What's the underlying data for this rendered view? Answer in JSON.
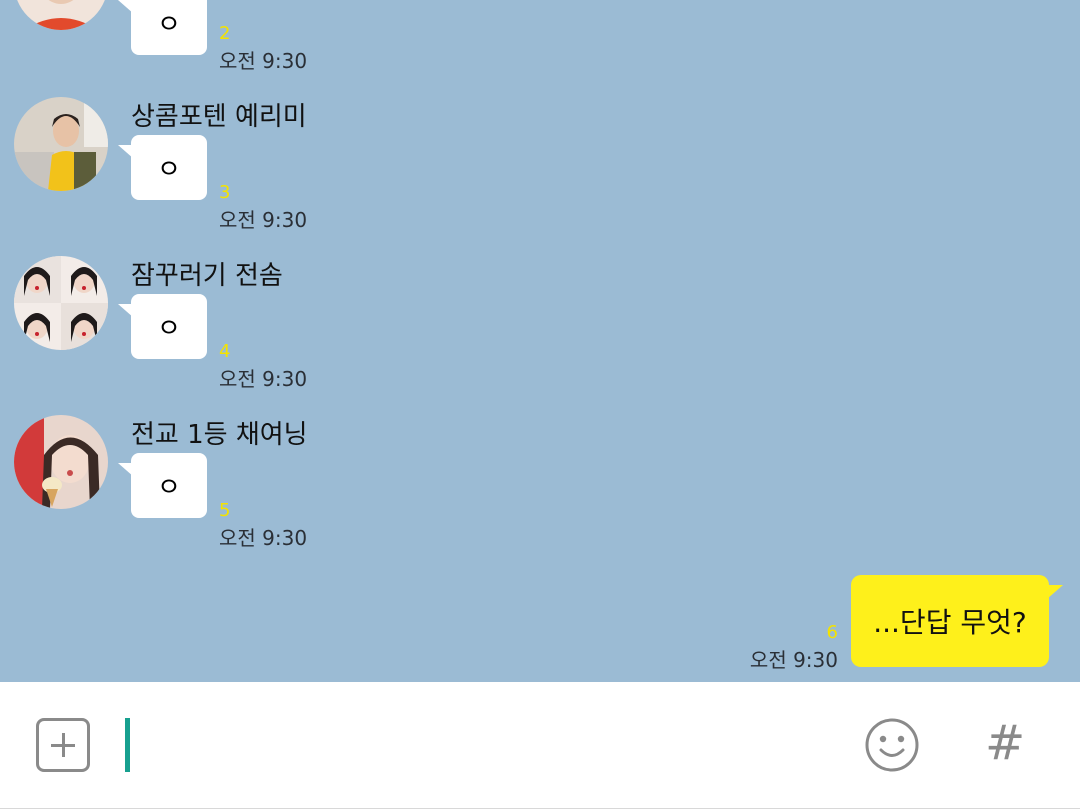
{
  "messages": [
    {
      "sender": "",
      "text": "ㅇ",
      "unread": "2",
      "time": "오전 9:30"
    },
    {
      "sender": "상콤포텐 예리미",
      "text": "ㅇ",
      "unread": "3",
      "time": "오전 9:30"
    },
    {
      "sender": "잠꾸러기 전솜",
      "text": "ㅇ",
      "unread": "4",
      "time": "오전 9:30"
    },
    {
      "sender": "전교 1등 채여닝",
      "text": "ㅇ",
      "unread": "5",
      "time": "오전 9:30"
    }
  ],
  "my_message": {
    "text": "...단답 무엇?",
    "unread": "6",
    "time": "오전 9:30"
  },
  "input": {
    "value": "",
    "hash_label": "#"
  },
  "colors": {
    "chat_background": "#9bbbd4",
    "my_bubble": "#fef01b",
    "unread_count": "#f4e300",
    "cursor": "#17a08f"
  },
  "icons": {
    "attach": "plus-square-icon",
    "emoji": "smile-icon",
    "hashtag": "hash-icon"
  }
}
